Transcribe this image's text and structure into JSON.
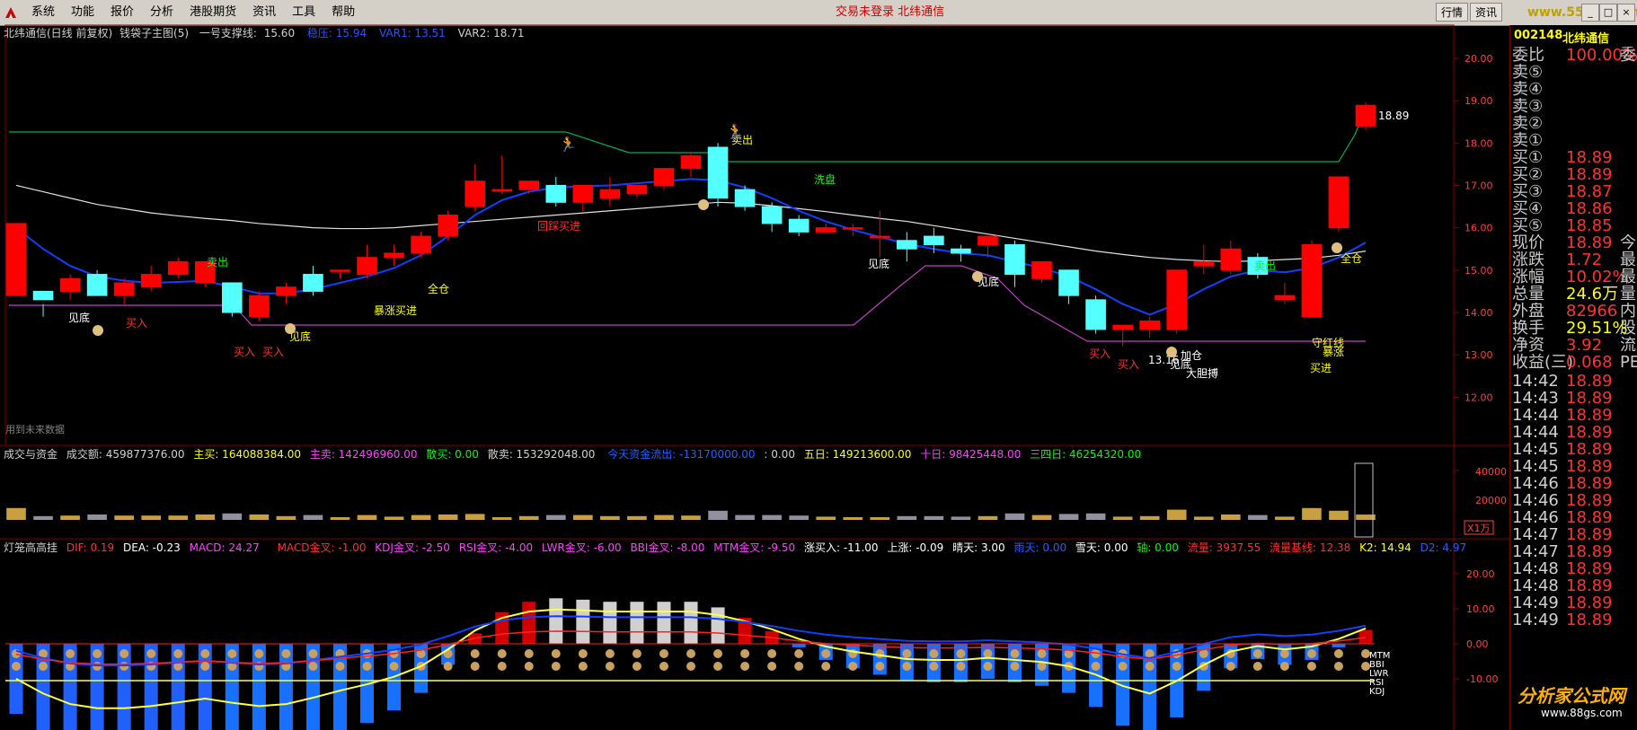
{
  "menu": {
    "items": [
      "系统",
      "功能",
      "报价",
      "分析",
      "港股期货",
      "资讯",
      "工具",
      "帮助"
    ],
    "center_text": "交易未登录  北纬通信",
    "right_tabs": [
      "行情",
      "资讯"
    ],
    "site": "www.55188.com"
  },
  "header": {
    "stock": "北纬通信(日线 前复权)",
    "indicator": "钱袋子主图(5)",
    "support_label": "一号支撑线:",
    "support_value": "15.60",
    "pressure": "稳压: 15.94",
    "var1": "VAR1: 13.51",
    "var2": "VAR2: 18.71"
  },
  "price_axis": [
    "20.00",
    "19.00",
    "18.00",
    "17.00",
    "16.00",
    "15.00",
    "14.00",
    "13.00",
    "12.00"
  ],
  "annotations": {
    "max_price": "18.89",
    "min_price": "13.16",
    "future_data": "用到未来数据",
    "signals": [
      "见底",
      "买入",
      "卖出",
      "买入",
      "买入",
      "见底",
      "暴涨买进",
      "全仓",
      "回踩买进",
      "卖出",
      "洗盘",
      "见底",
      "见底",
      "买入",
      "买入",
      "加仓",
      "见底",
      "大胆搏",
      "卖出",
      "全仓",
      "守红线",
      "暴涨",
      "买进"
    ]
  },
  "volume_header": {
    "title": "成交与资金",
    "amount": "成交额: 459877376.00",
    "main_buy": "主买: 164088384.00",
    "main_sell": "主卖: 142496960.00",
    "retail_buy": "散买: 0.00",
    "retail_sell": "散卖: 153292048.00",
    "today_flow": "今天资金流出: -13170000.00",
    "zero": ": 0.00",
    "five_day": "五日: 149213600.00",
    "ten_day": "十日: 98425448.00",
    "thirty_four_day": "三四日: 46254320.00"
  },
  "volume_axis": [
    "40000",
    "20000"
  ],
  "volume_unit": "X1万",
  "macd_header": {
    "title": "灯笼高高挂",
    "dif": "DIF: 0.19",
    "dea": "DEA: -0.23",
    "macd": "MACD: 24.27",
    "macd_cross": "MACD金叉: -1.00",
    "kdj_cross": "KDJ金叉: -2.50",
    "rsi_cross": "RSI金叉: -4.00",
    "lwr_cross": "LWR金叉: -6.00",
    "bbi_cross": "BBI金叉: -8.00",
    "mtm_cross": "MTM金叉: -9.50",
    "up_buy": "涨买入: -11.00",
    "up": "上涨: -0.09",
    "sunny": "晴天: 3.00",
    "rain": "雨天: 0.00",
    "snow": "雪天: 0.00",
    "axis": "轴: 0.00",
    "flow": "流量: 3937.55",
    "flow_base": "流量基线: 12.38",
    "k2": "K2: 14.94",
    "d2": "D2: 4.97"
  },
  "macd_axis": [
    "20.00",
    "10.00",
    "0.00",
    "-10.00"
  ],
  "macd_labels": [
    "MTM",
    "BBI",
    "LWR",
    "RSI",
    "KDJ"
  ],
  "right_panel": {
    "code": "002148",
    "name": "北纬通信",
    "rows": [
      {
        "label": "委比",
        "value": "100.00%",
        "extra": "委"
      },
      {
        "label": "卖⑤",
        "value": "",
        "extra": ""
      },
      {
        "label": "卖④",
        "value": "",
        "extra": ""
      },
      {
        "label": "卖③",
        "value": "",
        "extra": ""
      },
      {
        "label": "卖②",
        "value": "",
        "extra": ""
      },
      {
        "label": "卖①",
        "value": "",
        "extra": ""
      },
      {
        "label": "买①",
        "value": "18.89",
        "extra": ""
      },
      {
        "label": "买②",
        "value": "18.89",
        "extra": ""
      },
      {
        "label": "买③",
        "value": "18.87",
        "extra": ""
      },
      {
        "label": "买④",
        "value": "18.86",
        "extra": ""
      },
      {
        "label": "买⑤",
        "value": "18.85",
        "extra": ""
      },
      {
        "label": "现价",
        "value": "18.89",
        "extra": "今"
      },
      {
        "label": "涨跌",
        "value": "1.72",
        "extra": "最"
      },
      {
        "label": "涨幅",
        "value": "10.02%",
        "extra": "最"
      },
      {
        "label": "总量",
        "value": "24.6万",
        "extra": "量"
      },
      {
        "label": "外盘",
        "value": "82966",
        "extra": "内"
      },
      {
        "label": "换手",
        "value": "29.51%",
        "extra": "股"
      },
      {
        "label": "净资",
        "value": "3.92",
        "extra": "流"
      },
      {
        "label": "收益(三)",
        "value": "0.068",
        "extra": "PE"
      }
    ],
    "ticks": [
      {
        "time": "14:42",
        "price": "18.89"
      },
      {
        "time": "14:43",
        "price": "18.89"
      },
      {
        "time": "14:44",
        "price": "18.89"
      },
      {
        "time": "14:44",
        "price": "18.89"
      },
      {
        "time": "14:45",
        "price": "18.89"
      },
      {
        "time": "14:45",
        "price": "18.89"
      },
      {
        "time": "14:46",
        "price": "18.89"
      },
      {
        "time": "14:46",
        "price": "18.89"
      },
      {
        "time": "14:46",
        "price": "18.89"
      },
      {
        "time": "14:47",
        "price": "18.89"
      },
      {
        "time": "14:47",
        "price": "18.89"
      },
      {
        "time": "14:48",
        "price": "18.89"
      },
      {
        "time": "14:48",
        "price": "18.89"
      },
      {
        "time": "14:49",
        "price": "18.89"
      },
      {
        "time": "14:49",
        "price": "18.89"
      }
    ]
  },
  "footer": {
    "site": "分析家公式网",
    "url": "www.88gs.com"
  },
  "colors": {
    "up": "#ff0000",
    "down": "#54ffff",
    "ma_white": "#e6e6e6",
    "ma_blue": "#0050ff",
    "magenta": "#c040c0",
    "green_line": "#00c060"
  },
  "chart_data": {
    "type": "candlestick",
    "ylim": [
      11.5,
      20.4
    ],
    "candles": [
      {
        "o": 14.4,
        "h": 16.1,
        "l": 14.4,
        "c": 16.1
      },
      {
        "o": 14.5,
        "h": 14.2,
        "l": 13.9,
        "c": 14.3
      },
      {
        "o": 14.5,
        "h": 14.9,
        "l": 14.3,
        "c": 14.8
      },
      {
        "o": 14.9,
        "h": 15.0,
        "l": 14.4,
        "c": 14.4
      },
      {
        "o": 14.4,
        "h": 14.8,
        "l": 14.2,
        "c": 14.7
      },
      {
        "o": 14.6,
        "h": 15.1,
        "l": 14.5,
        "c": 14.9
      },
      {
        "o": 14.9,
        "h": 15.3,
        "l": 14.8,
        "c": 15.2
      },
      {
        "o": 14.7,
        "h": 15.2,
        "l": 14.6,
        "c": 15.2
      },
      {
        "o": 14.7,
        "h": 14.7,
        "l": 13.9,
        "c": 14.0
      },
      {
        "o": 13.9,
        "h": 14.5,
        "l": 13.8,
        "c": 14.4
      },
      {
        "o": 14.4,
        "h": 14.7,
        "l": 14.2,
        "c": 14.6
      },
      {
        "o": 14.9,
        "h": 15.1,
        "l": 14.4,
        "c": 14.5
      },
      {
        "o": 15.0,
        "h": 15.0,
        "l": 14.8,
        "c": 15.0
      },
      {
        "o": 14.9,
        "h": 15.6,
        "l": 14.8,
        "c": 15.3
      },
      {
        "o": 15.3,
        "h": 15.6,
        "l": 15.1,
        "c": 15.4
      },
      {
        "o": 15.4,
        "h": 15.9,
        "l": 15.3,
        "c": 15.8
      },
      {
        "o": 15.8,
        "h": 16.4,
        "l": 15.7,
        "c": 16.3
      },
      {
        "o": 16.5,
        "h": 17.5,
        "l": 16.4,
        "c": 17.1
      },
      {
        "o": 16.9,
        "h": 17.7,
        "l": 16.8,
        "c": 16.9
      },
      {
        "o": 16.9,
        "h": 17.1,
        "l": 16.8,
        "c": 17.1
      },
      {
        "o": 17.0,
        "h": 17.2,
        "l": 16.5,
        "c": 16.6
      },
      {
        "o": 16.6,
        "h": 17.0,
        "l": 16.4,
        "c": 17.0
      },
      {
        "o": 16.7,
        "h": 17.2,
        "l": 16.5,
        "c": 16.9
      },
      {
        "o": 16.8,
        "h": 17.0,
        "l": 16.7,
        "c": 17.0
      },
      {
        "o": 17.0,
        "h": 17.4,
        "l": 16.9,
        "c": 17.4
      },
      {
        "o": 17.4,
        "h": 17.8,
        "l": 17.2,
        "c": 17.7
      },
      {
        "o": 17.9,
        "h": 18.0,
        "l": 16.5,
        "c": 16.7
      },
      {
        "o": 16.9,
        "h": 17.0,
        "l": 16.4,
        "c": 16.5
      },
      {
        "o": 16.5,
        "h": 16.6,
        "l": 15.9,
        "c": 16.1
      },
      {
        "o": 16.2,
        "h": 16.3,
        "l": 15.8,
        "c": 15.9
      },
      {
        "o": 15.9,
        "h": 16.1,
        "l": 15.9,
        "c": 16.0
      },
      {
        "o": 16.0,
        "h": 16.1,
        "l": 15.8,
        "c": 16.0
      },
      {
        "o": 15.8,
        "h": 16.4,
        "l": 15.3,
        "c": 15.8
      },
      {
        "o": 15.7,
        "h": 15.9,
        "l": 15.2,
        "c": 15.5
      },
      {
        "o": 15.8,
        "h": 16.0,
        "l": 15.4,
        "c": 15.6
      },
      {
        "o": 15.5,
        "h": 15.6,
        "l": 15.2,
        "c": 15.4
      },
      {
        "o": 15.6,
        "h": 15.8,
        "l": 15.3,
        "c": 15.8
      },
      {
        "o": 15.6,
        "h": 15.7,
        "l": 14.6,
        "c": 14.9
      },
      {
        "o": 14.8,
        "h": 15.2,
        "l": 14.7,
        "c": 15.2
      },
      {
        "o": 15.0,
        "h": 15.0,
        "l": 14.2,
        "c": 14.4
      },
      {
        "o": 14.3,
        "h": 14.4,
        "l": 13.5,
        "c": 13.6
      },
      {
        "o": 13.6,
        "h": 13.7,
        "l": 13.2,
        "c": 13.7
      },
      {
        "o": 13.6,
        "h": 13.9,
        "l": 13.4,
        "c": 13.8
      },
      {
        "o": 13.6,
        "h": 15.0,
        "l": 13.5,
        "c": 15.0
      },
      {
        "o": 15.1,
        "h": 15.6,
        "l": 14.9,
        "c": 15.2
      },
      {
        "o": 15.0,
        "h": 15.7,
        "l": 14.9,
        "c": 15.5
      },
      {
        "o": 15.3,
        "h": 15.4,
        "l": 14.8,
        "c": 14.9
      },
      {
        "o": 14.3,
        "h": 14.7,
        "l": 14.2,
        "c": 14.4
      },
      {
        "o": 13.9,
        "h": 15.7,
        "l": 13.9,
        "c": 15.6
      },
      {
        "o": 16.0,
        "h": 17.2,
        "l": 15.9,
        "c": 17.2
      },
      {
        "o": 18.4,
        "h": 18.95,
        "l": 18.3,
        "c": 18.89
      }
    ],
    "ma_white": [
      17.0,
      16.85,
      16.7,
      16.55,
      16.45,
      16.35,
      16.28,
      16.22,
      16.17,
      16.1,
      16.05,
      16.0,
      15.98,
      15.98,
      16.0,
      16.05,
      16.1,
      16.15,
      16.2,
      16.25,
      16.3,
      16.35,
      16.4,
      16.45,
      16.5,
      16.55,
      16.6,
      16.58,
      16.52,
      16.45,
      16.38,
      16.3,
      16.22,
      16.15,
      16.05,
      15.95,
      15.85,
      15.75,
      15.65,
      15.55,
      15.45,
      15.37,
      15.3,
      15.25,
      15.22,
      15.2,
      15.22,
      15.25,
      15.28,
      15.35,
      15.45
    ],
    "ma_blue": [
      16.0,
      15.5,
      15.1,
      14.85,
      14.75,
      14.7,
      14.72,
      14.75,
      14.6,
      14.45,
      14.45,
      14.55,
      14.7,
      14.85,
      15.05,
      15.35,
      15.8,
      16.3,
      16.65,
      16.85,
      16.95,
      16.98,
      17.0,
      17.05,
      17.1,
      17.15,
      17.12,
      16.95,
      16.7,
      16.4,
      16.15,
      15.95,
      15.78,
      15.62,
      15.5,
      15.4,
      15.35,
      15.2,
      15.05,
      14.85,
      14.55,
      14.2,
      13.95,
      14.2,
      14.55,
      14.85,
      15.0,
      14.95,
      15.05,
      15.3,
      15.65
    ]
  }
}
